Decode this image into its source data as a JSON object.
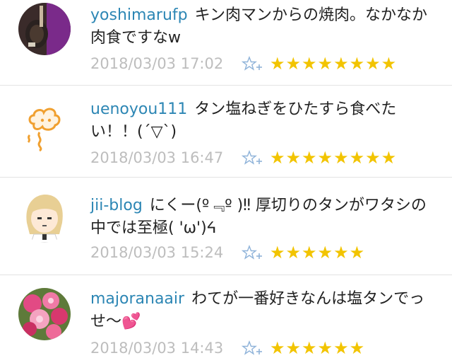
{
  "comments": [
    {
      "user": "yoshimarufp",
      "text": "キン肉マンからの焼肉。なかなか肉食ですなw",
      "timestamp": "2018/03/03 17:02",
      "stars": "★★★★★★★★",
      "avatar": "guitar-photo-avatar"
    },
    {
      "user": "uenoyou111",
      "text": "タン塩ねぎをひたすら食べたい！！(´▽`)",
      "timestamp": "2018/03/03 16:47",
      "stars": "★★★★★★★★",
      "avatar": "smoke-cloud-avatar"
    },
    {
      "user": "jii-blog",
      "text": "にくー(º﹃º )‼ 厚切りのタンがワタシの中では至極( 'ω')ᔦ",
      "timestamp": "2018/03/03 15:24",
      "stars": "★★★★★★",
      "avatar": "anime-girl-avatar"
    },
    {
      "user": "majoranaair",
      "text": "わてが一番好きなんは塩タンでっせ〜💕",
      "timestamp": "2018/03/03 14:43",
      "stars": "★★★★★★",
      "avatar": "pink-flowers-avatar"
    }
  ],
  "colors": {
    "username": "#2c86b4",
    "timestamp": "#bdbdbd",
    "star": "#f2c400",
    "star_add_icon": "#8fb3d9"
  }
}
